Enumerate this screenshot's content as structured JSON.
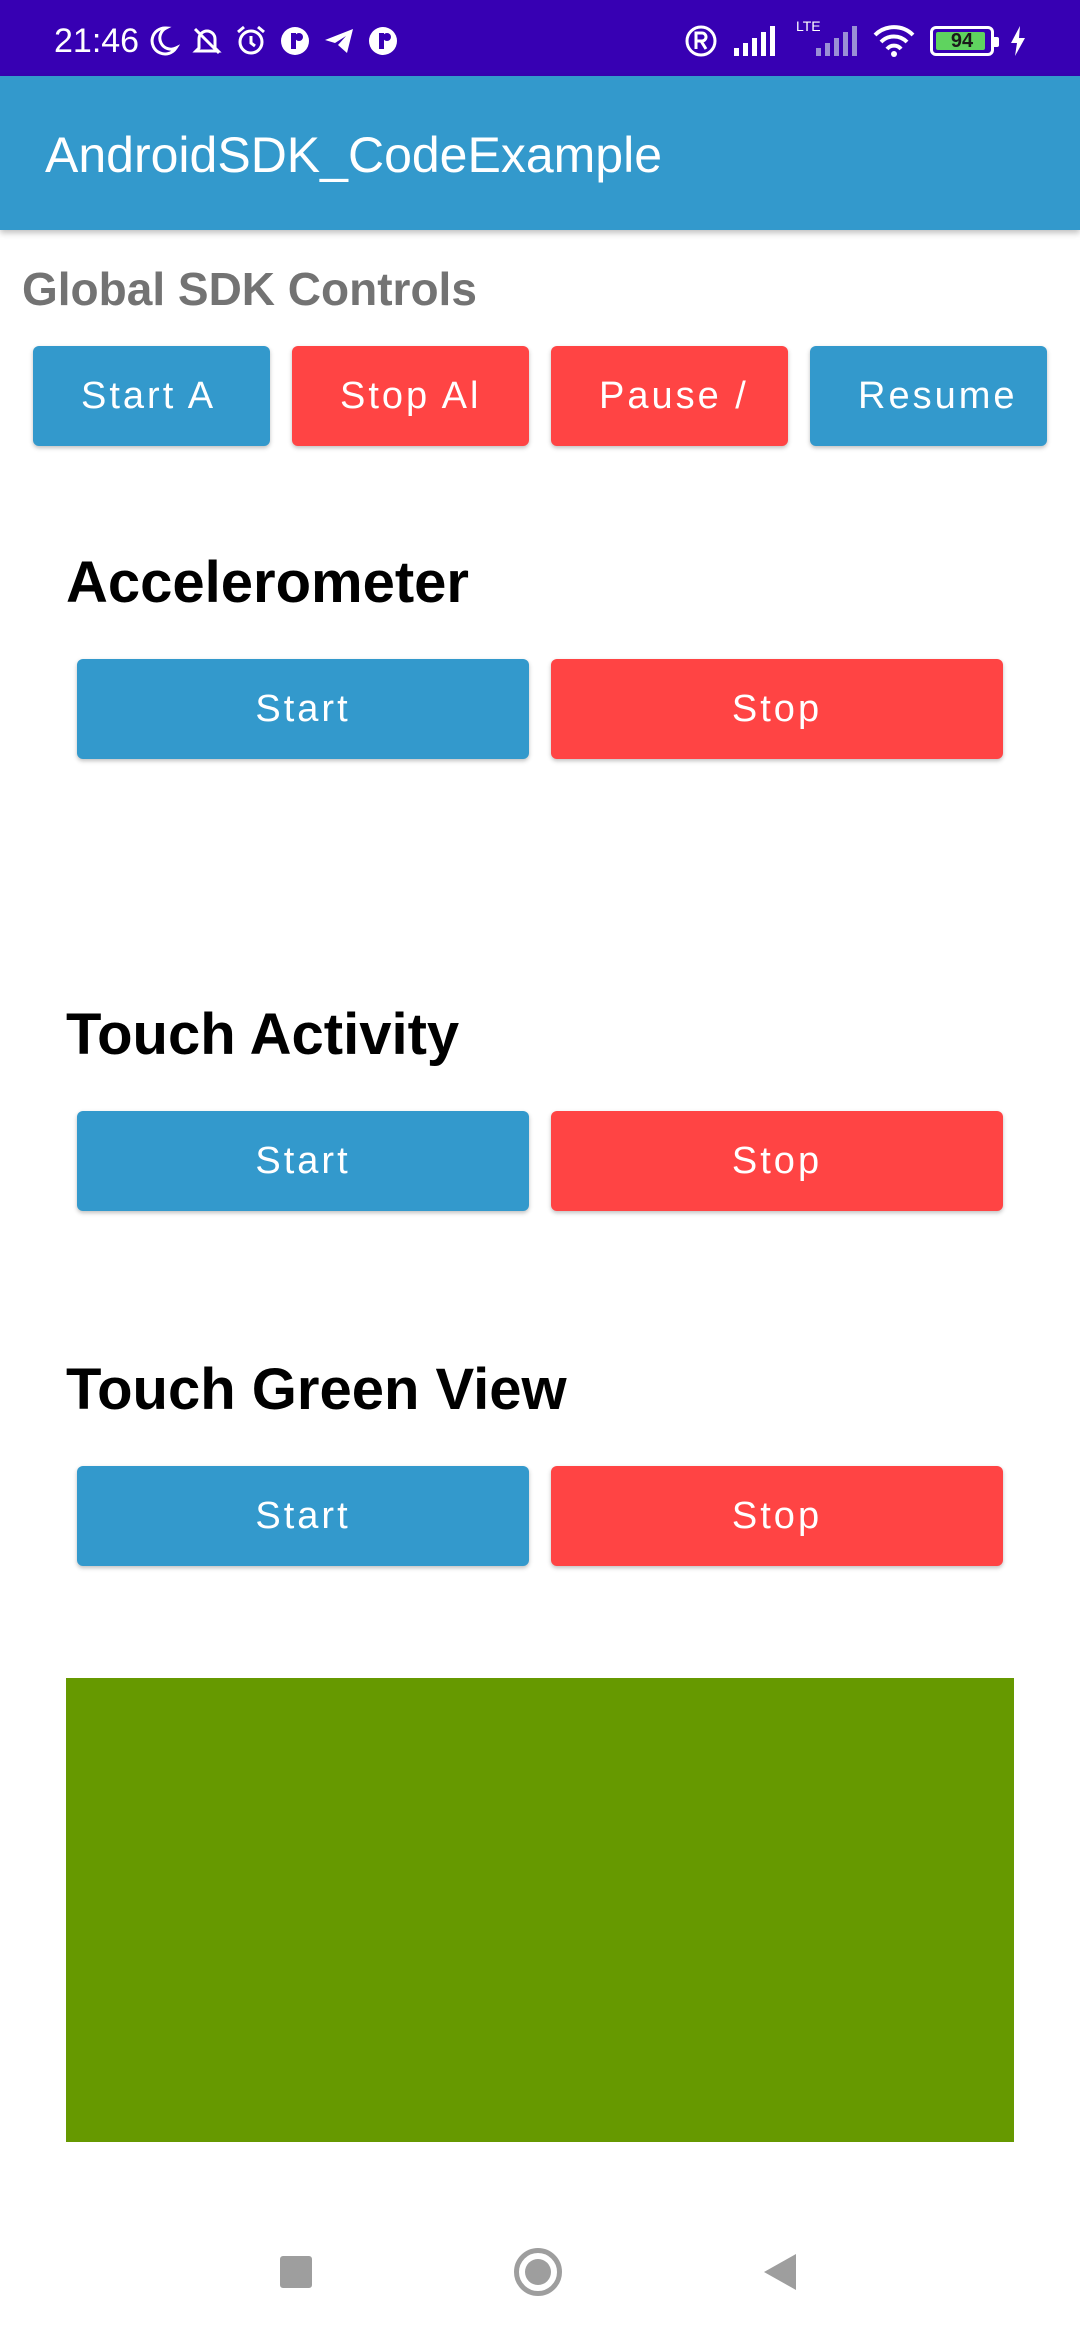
{
  "status_bar": {
    "time": "21:46",
    "left_icons": [
      "moon-icon",
      "bell-off-icon",
      "alarm-icon",
      "app-notification-icon",
      "telegram-icon",
      "app-notification-icon"
    ],
    "right_icons": [
      "registered-icon",
      "signal-icon",
      "lte-signal-icon",
      "wifi-icon"
    ],
    "network_label": "LTE",
    "battery_level": "94",
    "charging": true
  },
  "app_bar": {
    "title": "AndroidSDK_CodeExample"
  },
  "global_controls": {
    "title": "Global SDK Controls",
    "buttons": [
      {
        "label": "Start A",
        "color": "#3399cc"
      },
      {
        "label": "Stop Al",
        "color": "#ff4444"
      },
      {
        "label": "Pause /",
        "color": "#ff4444"
      },
      {
        "label": "Resume",
        "color": "#3399cc"
      }
    ]
  },
  "sections": [
    {
      "title": "Accelerometer",
      "start_label": "Start",
      "stop_label": "Stop"
    },
    {
      "title": "Touch Activity",
      "start_label": "Start",
      "stop_label": "Stop"
    },
    {
      "title": "Touch Green View",
      "start_label": "Start",
      "stop_label": "Stop"
    }
  ],
  "colors": {
    "status_bar": "#3700b3",
    "app_bar": "#3399cc",
    "start_button": "#3399cc",
    "stop_button": "#ff4444",
    "green_view": "#669900"
  },
  "nav_bar": {
    "icons": [
      "recents-icon",
      "home-icon",
      "back-icon"
    ]
  }
}
